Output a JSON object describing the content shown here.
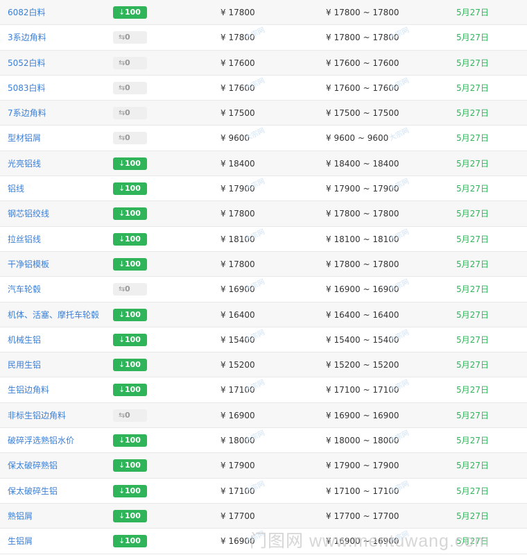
{
  "currency_symbol": "¥",
  "colors": {
    "link": "#3a7fd6",
    "down": "#2fb45a",
    "flat_bg": "#efefef",
    "date": "#2fb45a"
  },
  "icons": {
    "down": "down-arrow-icon",
    "flat": "flat-arrow-icon"
  },
  "rows": [
    {
      "name": "6082白料",
      "change": "100",
      "trend": "down",
      "price": "17800",
      "range": "17800 ~ 17800",
      "date": "5月27日"
    },
    {
      "name": "3系边角料",
      "change": "0",
      "trend": "flat",
      "price": "17800",
      "range": "17800 ~ 17800",
      "date": "5月27日"
    },
    {
      "name": "5052白料",
      "change": "0",
      "trend": "flat",
      "price": "17600",
      "range": "17600 ~ 17600",
      "date": "5月27日"
    },
    {
      "name": "5083白料",
      "change": "0",
      "trend": "flat",
      "price": "17600",
      "range": "17600 ~ 17600",
      "date": "5月27日"
    },
    {
      "name": "7系边角料",
      "change": "0",
      "trend": "flat",
      "price": "17500",
      "range": "17500 ~ 17500",
      "date": "5月27日"
    },
    {
      "name": "型材铝屑",
      "change": "0",
      "trend": "flat",
      "price": "9600",
      "range": "9600 ~ 9600",
      "date": "5月27日"
    },
    {
      "name": "光亮铝线",
      "change": "100",
      "trend": "down",
      "price": "18400",
      "range": "18400 ~ 18400",
      "date": "5月27日"
    },
    {
      "name": "铝线",
      "change": "100",
      "trend": "down",
      "price": "17900",
      "range": "17900 ~ 17900",
      "date": "5月27日"
    },
    {
      "name": "钢芯铝绞线",
      "change": "100",
      "trend": "down",
      "price": "17800",
      "range": "17800 ~ 17800",
      "date": "5月27日"
    },
    {
      "name": "拉丝铝线",
      "change": "100",
      "trend": "down",
      "price": "18100",
      "range": "18100 ~ 18100",
      "date": "5月27日"
    },
    {
      "name": "干净铝模板",
      "change": "100",
      "trend": "down",
      "price": "17800",
      "range": "17800 ~ 17800",
      "date": "5月27日"
    },
    {
      "name": "汽车轮毂",
      "change": "0",
      "trend": "flat",
      "price": "16900",
      "range": "16900 ~ 16900",
      "date": "5月27日"
    },
    {
      "name": "机体、活塞、摩托车轮毂",
      "change": "100",
      "trend": "down",
      "price": "16400",
      "range": "16400 ~ 16400",
      "date": "5月27日"
    },
    {
      "name": "机械生铝",
      "change": "100",
      "trend": "down",
      "price": "15400",
      "range": "15400 ~ 15400",
      "date": "5月27日"
    },
    {
      "name": "民用生铝",
      "change": "100",
      "trend": "down",
      "price": "15200",
      "range": "15200 ~ 15200",
      "date": "5月27日"
    },
    {
      "name": "生铝边角料",
      "change": "100",
      "trend": "down",
      "price": "17100",
      "range": "17100 ~ 17100",
      "date": "5月27日"
    },
    {
      "name": "非标生铝边角料",
      "change": "0",
      "trend": "flat",
      "price": "16900",
      "range": "16900 ~ 16900",
      "date": "5月27日"
    },
    {
      "name": "破碎浮选熟铝水价",
      "change": "100",
      "trend": "down",
      "price": "18000",
      "range": "18000 ~ 18000",
      "date": "5月27日"
    },
    {
      "name": "保太破碎熟铝",
      "change": "100",
      "trend": "down",
      "price": "17900",
      "range": "17900 ~ 17900",
      "date": "5月27日"
    },
    {
      "name": "保太破碎生铝",
      "change": "100",
      "trend": "down",
      "price": "17100",
      "range": "17100 ~ 17100",
      "date": "5月27日"
    },
    {
      "name": "熟铝屑",
      "change": "100",
      "trend": "down",
      "price": "17700",
      "range": "17700 ~ 17700",
      "date": "5月27日"
    },
    {
      "name": "生铝屑",
      "change": "100",
      "trend": "down",
      "price": "16900",
      "range": "16900 ~ 16900",
      "date": "5月27日"
    }
  ],
  "row_watermark": "大宗网",
  "footer_watermark": "门图网 www.mentuwang.com"
}
